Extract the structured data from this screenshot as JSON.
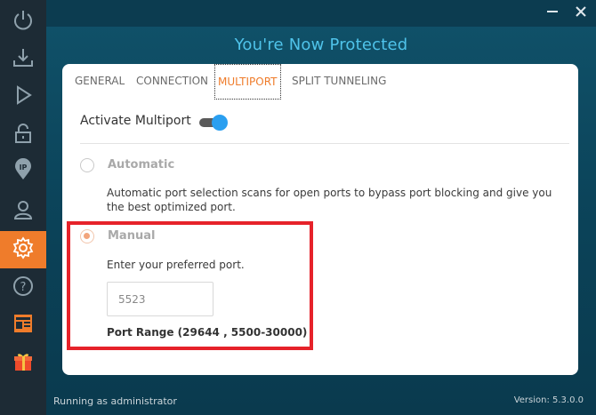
{
  "window": {
    "title": "You're Now Protected",
    "minimize_icon": "minimize-icon",
    "close_icon": "close-icon"
  },
  "sidebar": {
    "items": [
      {
        "id": "power",
        "icon": "power-icon",
        "active": false
      },
      {
        "id": "download",
        "icon": "download-icon",
        "active": false
      },
      {
        "id": "play",
        "icon": "play-icon",
        "active": false
      },
      {
        "id": "lock",
        "icon": "lock-icon",
        "active": false
      },
      {
        "id": "ip",
        "icon": "ip-location-icon",
        "label": "IP",
        "active": false
      },
      {
        "id": "account",
        "icon": "user-icon",
        "active": false
      },
      {
        "id": "settings",
        "icon": "gear-icon",
        "active": true
      },
      {
        "id": "help",
        "icon": "help-icon",
        "label": "?",
        "active": false
      },
      {
        "id": "news",
        "icon": "news-icon",
        "active": false
      },
      {
        "id": "gift",
        "icon": "gift-icon",
        "active": false
      }
    ],
    "active_color": "#ef7c2b"
  },
  "tabs": [
    {
      "label": "GENERAL",
      "active": false
    },
    {
      "label": "CONNECTION",
      "active": false
    },
    {
      "label": "MULTIPORT",
      "active": true
    },
    {
      "label": "SPLIT TUNNELING",
      "active": false
    }
  ],
  "multiport": {
    "activate_label": "Activate Multiport",
    "enabled": true,
    "automatic": {
      "label": "Automatic",
      "selected": false,
      "description": "Automatic port selection scans for open ports to bypass port blocking and give you the best optimized port."
    },
    "manual": {
      "label": "Manual",
      "selected": true,
      "instruction": "Enter your preferred port.",
      "port_value": "5523",
      "port_range": "Port Range (29644 , 5500-30000)"
    }
  },
  "status": {
    "running": "Running as administrator",
    "version": "Version:  5.3.0.0"
  },
  "colors": {
    "accent": "#ef7c2b",
    "title": "#4fc3ea",
    "toggle": "#2a9ff0",
    "highlight": "#e6222a"
  }
}
